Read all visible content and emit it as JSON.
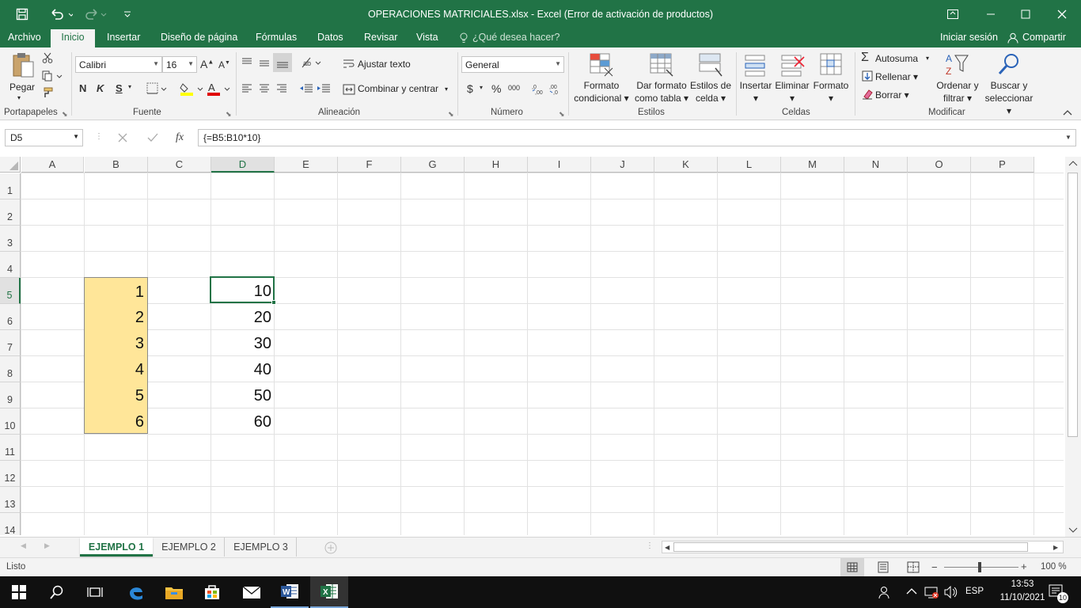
{
  "window": {
    "title": "OPERACIONES MATRICIALES.xlsx - Excel (Error de activación de productos)"
  },
  "ribbon_tabs": [
    "Archivo",
    "Inicio",
    "Insertar",
    "Diseño de página",
    "Fórmulas",
    "Datos",
    "Revisar",
    "Vista"
  ],
  "tell_me": "¿Qué desea hacer?",
  "signin": "Iniciar sesión",
  "share": "Compartir",
  "clipboard": {
    "paste": "Pegar",
    "group": "Portapapeles"
  },
  "font": {
    "name": "Calibri",
    "size": "16",
    "bold": "N",
    "italic": "K",
    "underline": "S",
    "group": "Fuente"
  },
  "alignment": {
    "wrap": "Ajustar texto",
    "merge": "Combinar y centrar",
    "group": "Alineación"
  },
  "number": {
    "format": "General",
    "currency": "$",
    "percent": "%",
    "thousands": "000",
    "group": "Número"
  },
  "styles": {
    "cond1": "Formato",
    "cond2": "condicional",
    "table1": "Dar formato",
    "table2": "como tabla",
    "cell1": "Estilos de",
    "cell2": "celda",
    "group": "Estilos"
  },
  "cells": {
    "insert": "Insertar",
    "delete": "Eliminar",
    "format": "Formato",
    "group": "Celdas"
  },
  "editing": {
    "autosum": "Autosuma",
    "fill": "Rellenar",
    "clear": "Borrar",
    "sort1": "Ordenar y",
    "sort2": "filtrar",
    "find1": "Buscar y",
    "find2": "seleccionar",
    "group": "Modificar"
  },
  "formula_bar": {
    "name_box": "D5",
    "formula": "{=B5:B10*10}",
    "fx": "fx"
  },
  "grid": {
    "columns": [
      "A",
      "B",
      "C",
      "D",
      "E",
      "F",
      "G",
      "H",
      "I",
      "J",
      "K",
      "L",
      "M",
      "N",
      "O",
      "P"
    ],
    "rows": [
      "1",
      "2",
      "3",
      "4",
      "5",
      "6",
      "7",
      "8",
      "9",
      "10",
      "11",
      "12",
      "13",
      "14"
    ],
    "column_b": [
      "1",
      "2",
      "3",
      "4",
      "5",
      "6"
    ],
    "column_d": [
      "10",
      "20",
      "30",
      "40",
      "50",
      "60"
    ],
    "highlight_color": "#ffe699",
    "selected_cell": "D5"
  },
  "sheets": [
    "EJEMPLO 1",
    "EJEMPLO 2",
    "EJEMPLO 3"
  ],
  "status": {
    "ready": "Listo",
    "zoom": "100 %"
  },
  "taskbar": {
    "lang": "ESP",
    "time": "13:53",
    "date": "11/10/2021",
    "notifications": "10"
  },
  "colors": {
    "accent": "#217346",
    "ribbon_bg": "#f3f3f3"
  }
}
